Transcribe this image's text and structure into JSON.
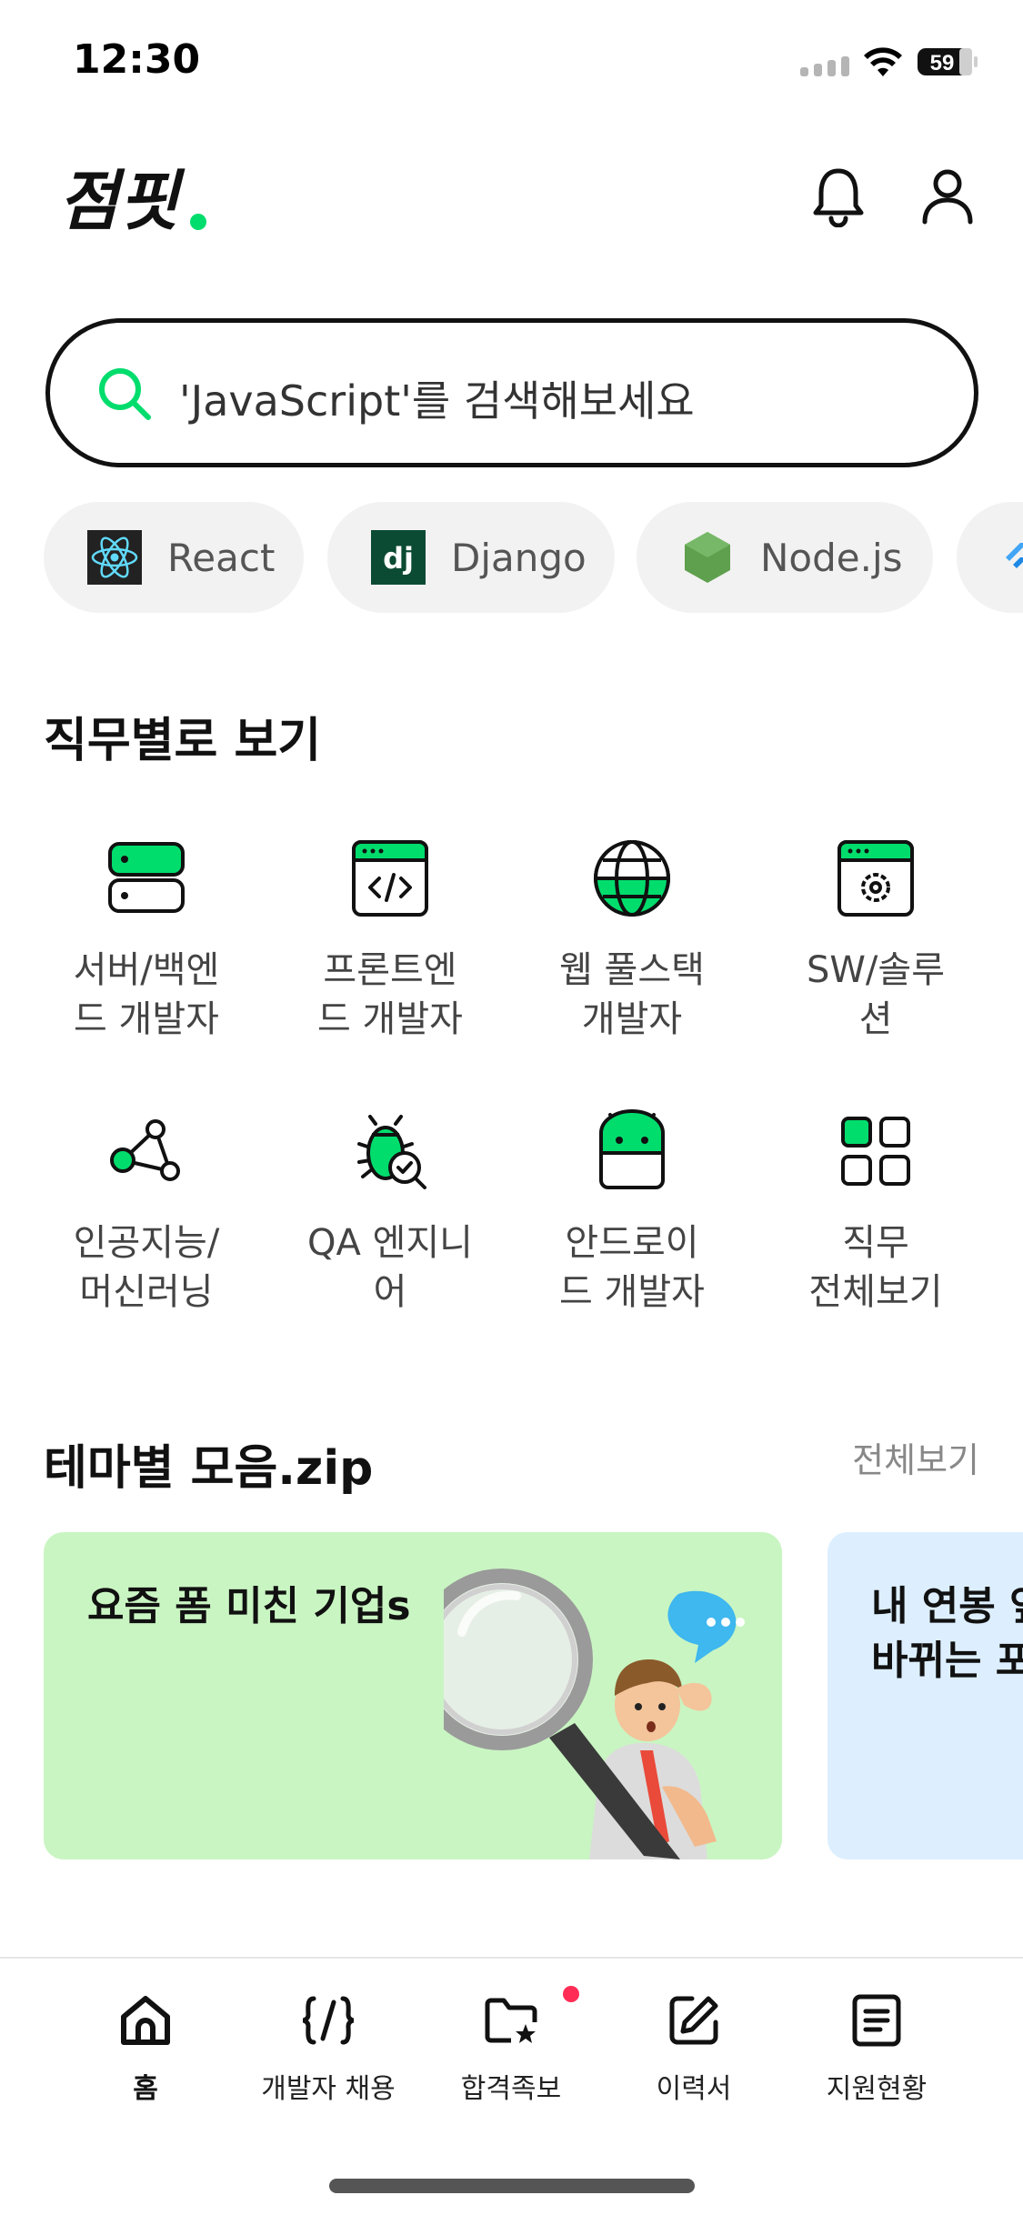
{
  "status_bar": {
    "time": "12:30",
    "battery": "59"
  },
  "header": {
    "logo_text": "점핏"
  },
  "search": {
    "placeholder": "'JavaScript'를 검색해보세요"
  },
  "chips": [
    {
      "label": "React",
      "icon": "react-logo-icon"
    },
    {
      "label": "Django",
      "icon": "django-logo-icon",
      "icon_text": "dj"
    },
    {
      "label": "Node.js",
      "icon": "nodejs-logo-icon"
    }
  ],
  "jobs": {
    "title": "직무별로 보기",
    "items": [
      {
        "label": "서버/백엔\n드 개발자",
        "icon": "server-icon"
      },
      {
        "label": "프론트엔\n드 개발자",
        "icon": "code-window-icon"
      },
      {
        "label": "웹 풀스택\n개발자",
        "icon": "globe-icon"
      },
      {
        "label": "SW/솔루\n션",
        "icon": "gear-window-icon"
      },
      {
        "label": "인공지능/\n머신러닝",
        "icon": "nodes-graph-icon"
      },
      {
        "label": "QA 엔지니\n어",
        "icon": "bug-check-icon"
      },
      {
        "label": "안드로이\n드 개발자",
        "icon": "android-icon"
      },
      {
        "label": "직무\n전체보기",
        "icon": "grid-icon"
      }
    ]
  },
  "themes": {
    "title": "테마별 모음.zip",
    "see_all": "전체보기",
    "cards": [
      {
        "title": "요즘 폼 미친 기업s"
      },
      {
        "title": "내 연봉 앞\n바뀌는 포"
      }
    ]
  },
  "tabbar": [
    {
      "label": "홈",
      "icon": "home-icon",
      "active": true
    },
    {
      "label": "개발자 채용",
      "icon": "code-braces-icon",
      "active": false
    },
    {
      "label": "합격족보",
      "icon": "folder-star-icon",
      "active": false,
      "badge": true
    },
    {
      "label": "이력서",
      "icon": "edit-icon",
      "active": false
    },
    {
      "label": "지원현황",
      "icon": "document-list-icon",
      "active": false
    }
  ],
  "colors": {
    "brand_green": "#00dd6d",
    "badge_red": "#ff2d55"
  }
}
